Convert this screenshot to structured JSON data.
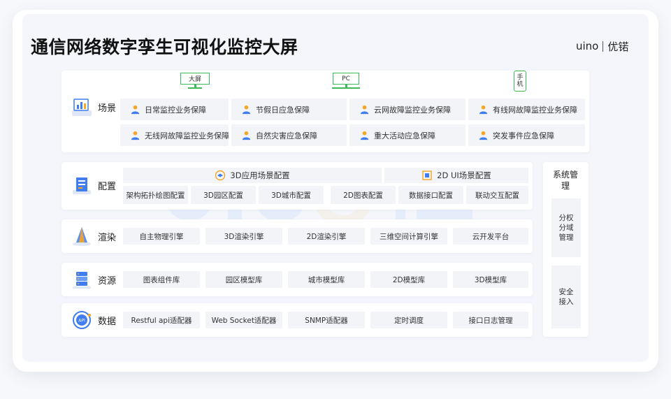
{
  "title": "通信网络数字孪生可视化监控大屏",
  "logo": {
    "latin": "uino",
    "chinese": "优锘"
  },
  "devices": [
    {
      "label": "大屏"
    },
    {
      "label": "PC"
    },
    {
      "label": "手机"
    }
  ],
  "rows": {
    "scene": {
      "label": "场景",
      "items": [
        "日常监控业务保障",
        "节假日应急保障",
        "云网故障监控业务保障",
        "有线网故障监控业务保障",
        "无线网故障监控业务保障",
        "自然灾害应急保障",
        "重大活动应急保障",
        "突发事件应急保障"
      ]
    },
    "config": {
      "label": "配置",
      "groups": [
        "3D应用场景配置",
        "2D UI场景配置"
      ],
      "items": [
        "架构拓扑绘图配置",
        "3D园区配置",
        "3D城市配置",
        "2D图表配置",
        "数据接口配置",
        "联动交互配置"
      ]
    },
    "render": {
      "label": "渲染",
      "items": [
        "自主物理引擎",
        "3D渲染引擎",
        "2D渲染引擎",
        "三维空间计算引擎",
        "云开发平台"
      ]
    },
    "resource": {
      "label": "资源",
      "items": [
        "图表组件库",
        "园区模型库",
        "城市模型库",
        "2D模型库",
        "3D模型库"
      ]
    },
    "data": {
      "label": "数据",
      "items": [
        "Restful api适配器",
        "Web Socket适配器",
        "SNMP适配器",
        "定时调度",
        "接口日志管理"
      ]
    }
  },
  "system": {
    "title": "系统管理",
    "items": [
      "分权分域管理",
      "安全接入"
    ]
  },
  "colors": {
    "accent_blue": "#3f7df0",
    "accent_orange": "#f5a623",
    "device_green": "#3dbb5a"
  }
}
